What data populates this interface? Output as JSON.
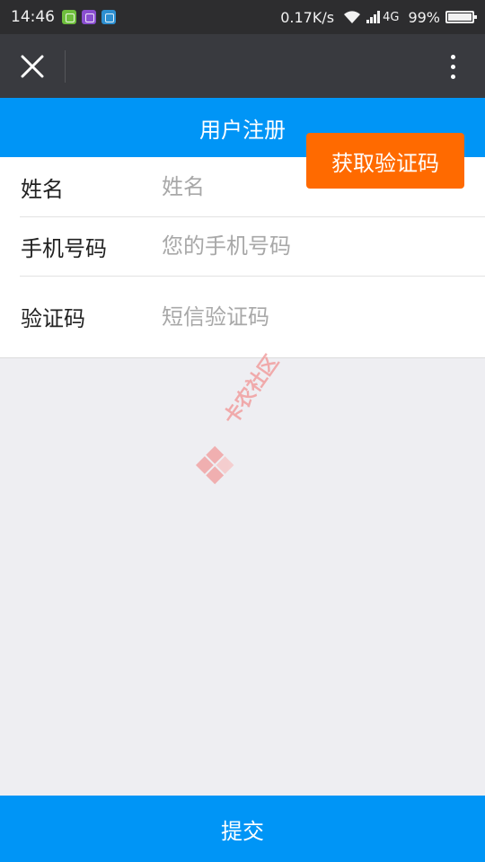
{
  "status_bar": {
    "time": "14:46",
    "network_speed": "0.17K/s",
    "network_type": "4G",
    "battery": "99%",
    "app_icons": [
      "green-app-icon",
      "purple-app-icon",
      "blue-app-icon"
    ]
  },
  "title_bar": {
    "close_icon": "close-icon",
    "more_icon": "more-vertical-icon"
  },
  "page": {
    "title": "用户注册"
  },
  "form": {
    "name": {
      "label": "姓名",
      "placeholder": "姓名",
      "value": ""
    },
    "phone": {
      "label": "手机号码",
      "placeholder": "您的手机号码",
      "value": ""
    },
    "code": {
      "label": "验证码",
      "placeholder": "短信验证码",
      "value": "",
      "button_label": "获取验证码"
    }
  },
  "watermark": {
    "text": "卡农社区"
  },
  "submit": {
    "label": "提交"
  },
  "colors": {
    "primary": "#0095f6",
    "accent": "#ff6a00",
    "title_bar": "#393a3f",
    "status_bar": "#2d2d2f",
    "background": "#eeeef2",
    "watermark": "#f19a9a"
  }
}
